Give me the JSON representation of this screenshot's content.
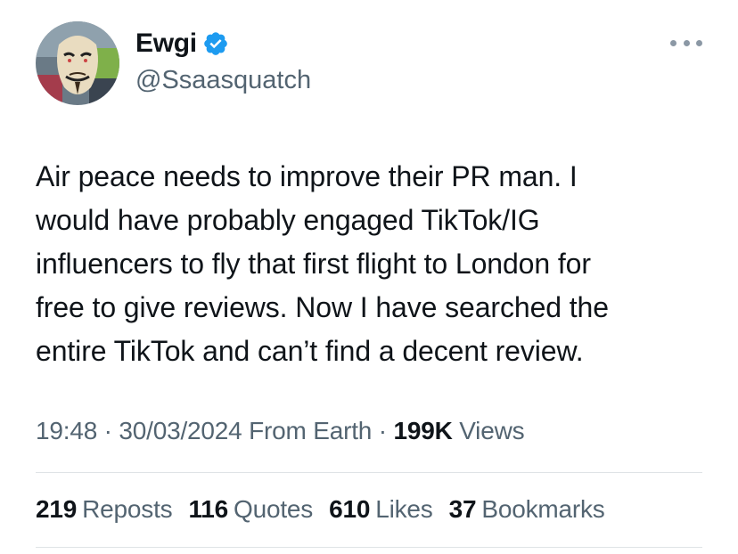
{
  "author": {
    "display_name": "Ewgi",
    "handle": "@Ssaasquatch",
    "verified": true,
    "avatar_icon": "guy-fawkes-mask-avatar",
    "verified_icon": "verified-badge-icon",
    "accent_color": "#1d9bf0"
  },
  "menu": {
    "icon": "more-dots-icon"
  },
  "tweet": {
    "lines": [
      "Air peace needs to improve their PR man. I",
      "would have probably engaged TikTok/IG",
      "influencers to fly that first flight to London for",
      "free to give reviews. Now I have searched the",
      "entire TikTok and can’t find a decent review."
    ]
  },
  "meta": {
    "time": "19:48",
    "sep1": "·",
    "date": "30/03/2024",
    "source": "From Earth",
    "sep2": "·",
    "views_count": "199K",
    "views_label": "Views"
  },
  "stats": {
    "reposts_count": "219",
    "reposts_label": "Reposts",
    "quotes_count": "116",
    "quotes_label": "Quotes",
    "likes_count": "610",
    "likes_label": "Likes",
    "bookmarks_count": "37",
    "bookmarks_label": "Bookmarks"
  }
}
